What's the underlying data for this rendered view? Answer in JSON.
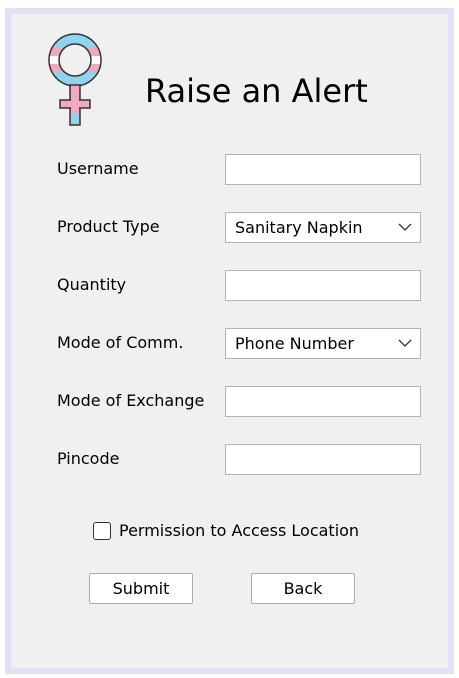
{
  "form": {
    "title": "Raise an Alert",
    "fields": [
      {
        "label": "Username",
        "value": ""
      },
      {
        "label": "Product Type",
        "selected": "Sanitary Napkin"
      },
      {
        "label": "Quantity",
        "value": ""
      },
      {
        "label": "Mode of Comm.",
        "selected": "Phone Number"
      },
      {
        "label": "Mode of Exchange",
        "value": ""
      },
      {
        "label": "Pincode",
        "value": ""
      }
    ],
    "permission_label": "Permission to Access Location",
    "permission_checked": false,
    "submit_label": "Submit",
    "back_label": "Back"
  },
  "icons": {
    "logo": "female-symbol-icon",
    "dropdown": "chevron-down-icon"
  },
  "colors": {
    "window_border": "#e0e0f6",
    "background": "#f0f0f0",
    "logo_blue": "#8fd3ee",
    "logo_pink": "#f2a9bf"
  }
}
